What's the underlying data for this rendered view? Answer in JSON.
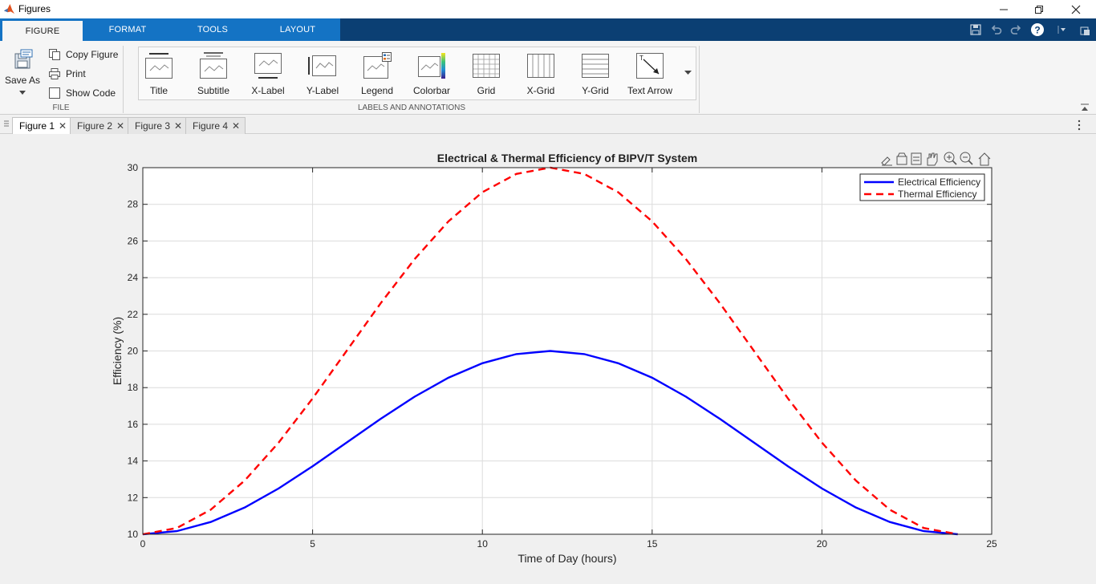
{
  "window": {
    "title": "Figures"
  },
  "ribbon_tabs": [
    {
      "label": "FIGURE",
      "active": true
    },
    {
      "label": "FORMAT",
      "active": false
    },
    {
      "label": "TOOLS",
      "active": false
    },
    {
      "label": "LAYOUT",
      "active": false
    }
  ],
  "file_section": {
    "save_as": "Save As",
    "copy_figure": "Copy Figure",
    "print": "Print",
    "show_code": "Show Code",
    "label": "FILE"
  },
  "labels_section": {
    "items": [
      "Title",
      "Subtitle",
      "X-Label",
      "Y-Label",
      "Legend",
      "Colorbar",
      "Grid",
      "X-Grid",
      "Y-Grid",
      "Text Arrow"
    ],
    "label": "LABELS AND ANNOTATIONS"
  },
  "figure_tabs": [
    "Figure 1",
    "Figure 2",
    "Figure 3",
    "Figure 4"
  ],
  "active_figure_tab": "Figure 1",
  "colors": {
    "electrical": "#0000ff",
    "thermal": "#ff0000",
    "tab_active_bg": "#1473c4",
    "tab_strip_bg": "#0b3f73"
  },
  "chart_data": {
    "type": "line",
    "title": "Electrical & Thermal Efficiency of BIPV/T System",
    "xlabel": "Time of Day (hours)",
    "ylabel": "Efficiency (%)",
    "xlim": [
      0,
      25
    ],
    "ylim": [
      10,
      30
    ],
    "xticks": [
      0,
      5,
      10,
      15,
      20,
      25
    ],
    "yticks": [
      10,
      12,
      14,
      16,
      18,
      20,
      22,
      24,
      26,
      28,
      30
    ],
    "grid": true,
    "legend_location": "top-right",
    "x": [
      0,
      1,
      2,
      3,
      4,
      5,
      6,
      7,
      8,
      9,
      10,
      11,
      12,
      13,
      14,
      15,
      16,
      17,
      18,
      19,
      20,
      21,
      22,
      23,
      24
    ],
    "series": [
      {
        "name": "Electrical Efficiency",
        "style": "solid",
        "color": "#0000ff",
        "values": [
          10.0,
          10.17,
          10.67,
          11.46,
          12.5,
          13.71,
          15.0,
          16.29,
          17.5,
          18.54,
          19.33,
          19.83,
          20.0,
          19.83,
          19.33,
          18.54,
          17.5,
          16.29,
          15.0,
          13.71,
          12.5,
          11.46,
          10.67,
          10.17,
          10.0
        ]
      },
      {
        "name": "Thermal Efficiency",
        "style": "dashed",
        "color": "#ff0000",
        "values": [
          10.0,
          10.34,
          11.34,
          12.93,
          15.0,
          17.41,
          20.0,
          22.59,
          25.0,
          27.07,
          28.66,
          29.66,
          30.0,
          29.66,
          28.66,
          27.07,
          25.0,
          22.59,
          20.0,
          17.41,
          15.0,
          12.93,
          11.34,
          10.34,
          10.0
        ]
      }
    ]
  }
}
